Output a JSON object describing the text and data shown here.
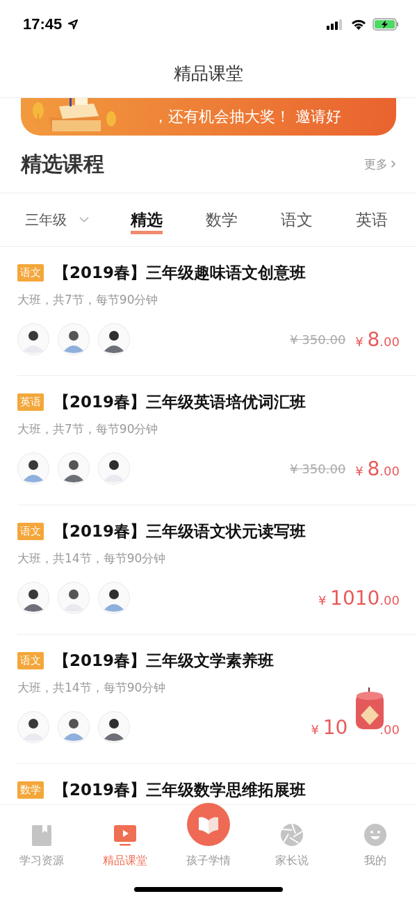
{
  "status_bar": {
    "time": "17:45"
  },
  "header": {
    "title": "精品课堂"
  },
  "banner": {
    "text": "，还有机会抽大奖！ 邀请好"
  },
  "section": {
    "title": "精选课程",
    "more": "更多"
  },
  "filter": {
    "grade": "三年级"
  },
  "tabs": [
    {
      "label": "精选",
      "selected": true
    },
    {
      "label": "数学",
      "selected": false
    },
    {
      "label": "语文",
      "selected": false
    },
    {
      "label": "英语",
      "selected": false
    }
  ],
  "courses": [
    {
      "tag": "语文",
      "title": "【2019春】三年级趣味语文创意班",
      "meta": "大班，共7节，每节90分钟",
      "teachers": [
        {
          "kind": "avatar"
        },
        {
          "kind": "avatar"
        },
        {
          "kind": "avatar"
        }
      ],
      "old_price": "¥ 350.00",
      "currency": "¥",
      "amount": "8",
      "decimals": ".00",
      "covered": false
    },
    {
      "tag": "英语",
      "title": "【2019春】三年级英语培优词汇班",
      "meta": "大班，共7节，每节90分钟",
      "teachers": [
        {
          "kind": "avatar"
        },
        {
          "kind": "avatar"
        },
        {
          "kind": "avatar"
        }
      ],
      "old_price": "¥ 350.00",
      "currency": "¥",
      "amount": "8",
      "decimals": ".00",
      "covered": false
    },
    {
      "tag": "语文",
      "title": "【2019春】三年级语文状元读写班",
      "meta": "大班，共14节，每节90分钟",
      "teachers": [
        {
          "kind": "avatar"
        },
        {
          "kind": "avatar"
        },
        {
          "kind": "avatar"
        }
      ],
      "currency": "¥",
      "amount": "1010",
      "decimals": ".00",
      "covered": false
    },
    {
      "tag": "语文",
      "title": "【2019春】三年级文学素养班",
      "meta": "大班，共14节，每节90分钟",
      "teachers": [
        {
          "kind": "avatar"
        },
        {
          "kind": "avatar"
        },
        {
          "kind": "avatar"
        }
      ],
      "currency": "¥",
      "amount": "10",
      "decimals": ".00",
      "covered": true
    },
    {
      "tag": "数学",
      "title": "【2019春】三年级数学思维拓展班"
    }
  ],
  "tab_bar": [
    {
      "kind": "book",
      "label": "学习资源",
      "selected": false
    },
    {
      "kind": "tv",
      "label": "精品课堂",
      "selected": true
    },
    {
      "kind": "center",
      "label": "孩子学情",
      "selected": false
    },
    {
      "kind": "aperture",
      "label": "家长说",
      "selected": false
    },
    {
      "kind": "smile",
      "label": "我的",
      "selected": false
    }
  ]
}
